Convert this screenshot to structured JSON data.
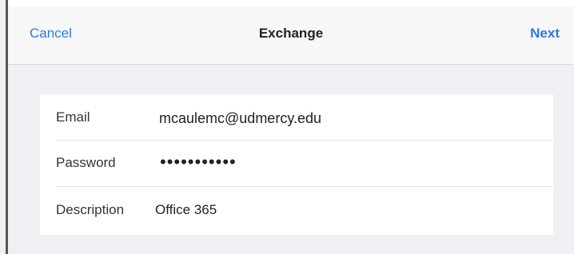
{
  "navbar": {
    "cancel_label": "Cancel",
    "title": "Exchange",
    "next_label": "Next"
  },
  "form": {
    "fields": [
      {
        "label": "Email",
        "value": "mcaulemc@udmercy.edu"
      },
      {
        "label": "Password",
        "value": "•••••••••••"
      },
      {
        "label": "Description",
        "value": "Office 365"
      }
    ]
  },
  "colors": {
    "accent": "#2a7ae2",
    "background": "#efeff4",
    "navbar": "#f7f7f8"
  }
}
